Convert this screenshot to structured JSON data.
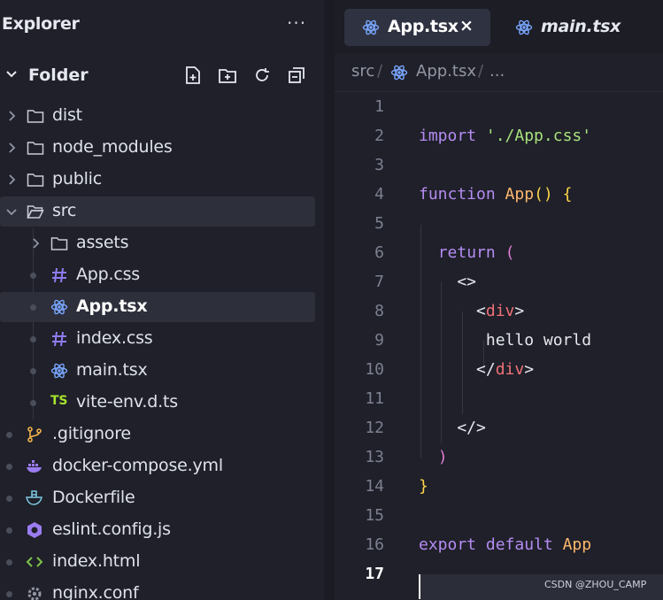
{
  "explorer": {
    "title": "Explorer",
    "more": "···",
    "root_folder": "Folder",
    "toolbar_icons": [
      "new-file-icon",
      "new-folder-icon",
      "refresh-icon",
      "collapse-all-icon"
    ],
    "items": [
      {
        "label": "dist",
        "type": "folder",
        "icon": "folder-icon"
      },
      {
        "label": "node_modules",
        "type": "folder",
        "icon": "folder-icon"
      },
      {
        "label": "public",
        "type": "folder",
        "icon": "folder-icon"
      },
      {
        "label": "src",
        "type": "folder-open",
        "icon": "folder-open-icon"
      },
      {
        "label": "assets",
        "type": "folder",
        "icon": "folder-icon"
      },
      {
        "label": "App.css",
        "type": "file",
        "icon": "hash-icon"
      },
      {
        "label": "App.tsx",
        "type": "file",
        "icon": "react-icon",
        "selected": true
      },
      {
        "label": "index.css",
        "type": "file",
        "icon": "hash-icon"
      },
      {
        "label": "main.tsx",
        "type": "file",
        "icon": "react-icon"
      },
      {
        "label": "vite-env.d.ts",
        "type": "file",
        "icon": "typescript-icon",
        "icon_text": "TS"
      },
      {
        "label": ".gitignore",
        "type": "file",
        "icon": "git-icon"
      },
      {
        "label": "docker-compose.yml",
        "type": "file",
        "icon": "docker-icon"
      },
      {
        "label": "Dockerfile",
        "type": "file",
        "icon": "dockerfile-icon"
      },
      {
        "label": "eslint.config.js",
        "type": "file",
        "icon": "eslint-icon"
      },
      {
        "label": "index.html",
        "type": "file",
        "icon": "html-icon"
      },
      {
        "label": "nginx.conf",
        "type": "file",
        "icon": "gear-icon"
      }
    ]
  },
  "tabs": [
    {
      "label": "App.tsx",
      "active": true,
      "close": "×"
    },
    {
      "label": "main.tsx",
      "active": false
    }
  ],
  "breadcrumb": {
    "parts": [
      "src",
      "App.tsx",
      "..."
    ],
    "sep": "/"
  },
  "code": {
    "line_numbers": [
      "1",
      "2",
      "3",
      "4",
      "5",
      "6",
      "7",
      "8",
      "9",
      "10",
      "11",
      "12",
      "13",
      "14",
      "15",
      "16",
      "17"
    ],
    "current_line": "17",
    "lines": [
      [],
      [
        {
          "t": "import",
          "c": "kw"
        },
        {
          "t": " ",
          "c": "pl"
        },
        {
          "t": "'./App.css'",
          "c": "str"
        }
      ],
      [],
      [
        {
          "t": "function",
          "c": "kw"
        },
        {
          "t": " ",
          "c": "pl"
        },
        {
          "t": "App",
          "c": "fn"
        },
        {
          "t": "()",
          "c": "br1"
        },
        {
          "t": " ",
          "c": "pl"
        },
        {
          "t": "{",
          "c": "br1"
        }
      ],
      [],
      [
        {
          "t": "  ",
          "c": "pl"
        },
        {
          "t": "return",
          "c": "kw"
        },
        {
          "t": " ",
          "c": "pl"
        },
        {
          "t": "(",
          "c": "br2"
        }
      ],
      [
        {
          "t": "    <>",
          "c": "pl"
        }
      ],
      [
        {
          "t": "      <",
          "c": "pl"
        },
        {
          "t": "div",
          "c": "tag"
        },
        {
          "t": ">",
          "c": "pl"
        }
      ],
      [
        {
          "t": "       hello world",
          "c": "pl"
        }
      ],
      [
        {
          "t": "      </",
          "c": "pl"
        },
        {
          "t": "div",
          "c": "tag"
        },
        {
          "t": ">",
          "c": "pl"
        }
      ],
      [],
      [
        {
          "t": "    </>",
          "c": "pl"
        }
      ],
      [
        {
          "t": "  ",
          "c": "pl"
        },
        {
          "t": ")",
          "c": "br2"
        }
      ],
      [
        {
          "t": "}",
          "c": "br1"
        }
      ],
      [],
      [
        {
          "t": "export",
          "c": "kw"
        },
        {
          "t": " ",
          "c": "pl"
        },
        {
          "t": "default",
          "c": "kw"
        },
        {
          "t": " ",
          "c": "pl"
        },
        {
          "t": "App",
          "c": "fn"
        }
      ],
      []
    ]
  },
  "watermark": "CSDN @ZHOU_CAMP",
  "colors": {
    "background": "#1f2029",
    "selected_row": "#2d2f3b",
    "keyword": "#b58cf2",
    "string": "#a8e27e",
    "function": "#ffb86c",
    "react": "#7aa7ff"
  }
}
